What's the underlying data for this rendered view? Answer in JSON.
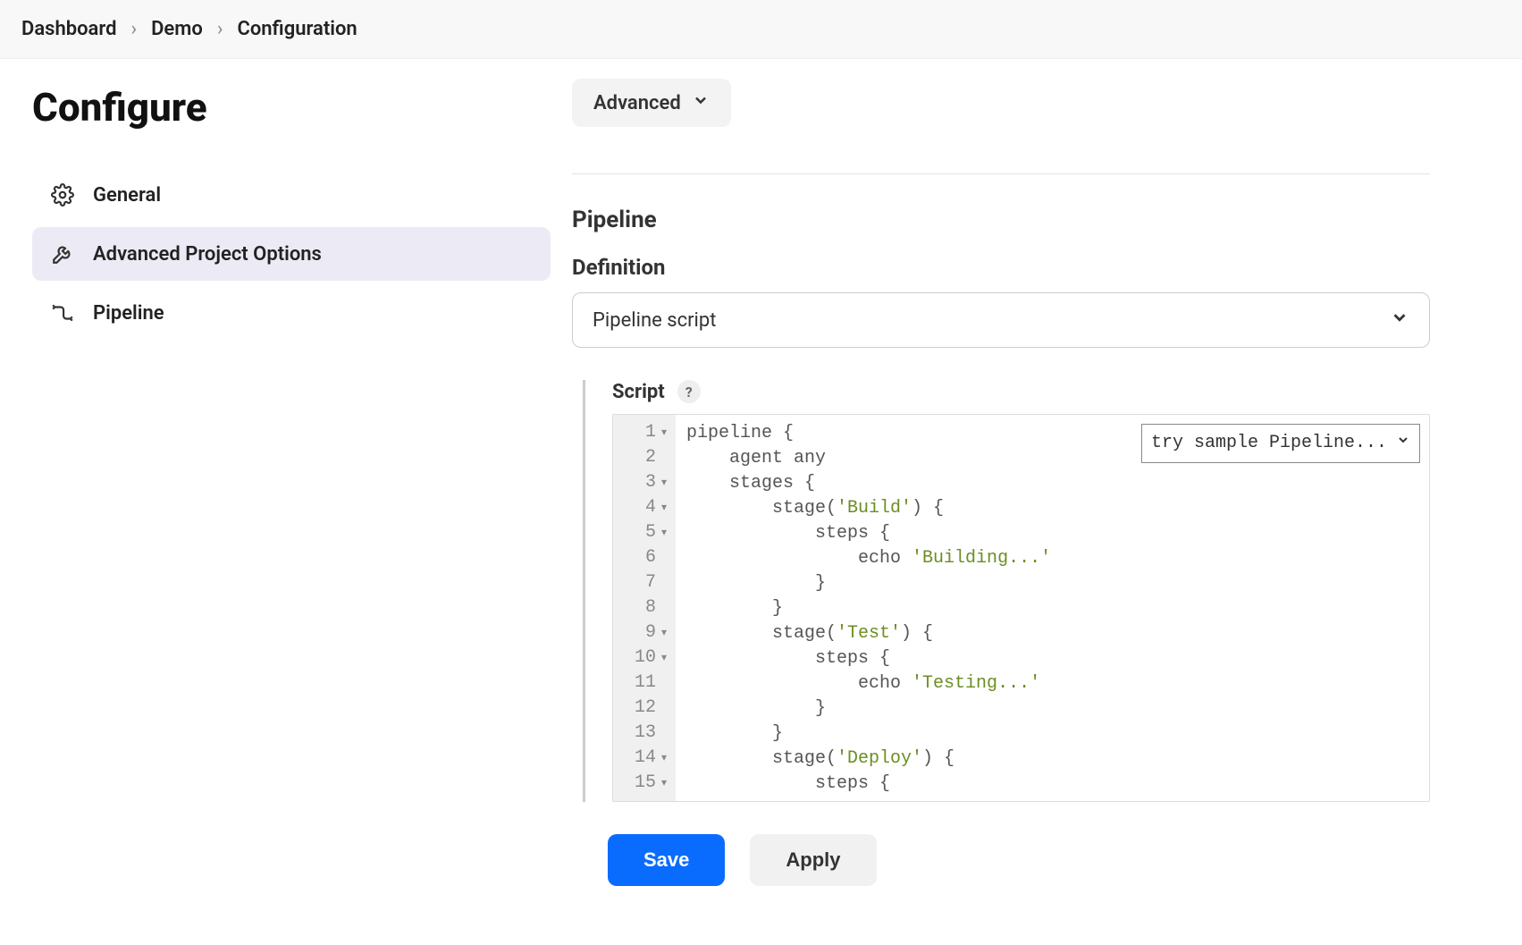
{
  "breadcrumb": {
    "items": [
      "Dashboard",
      "Demo",
      "Configuration"
    ]
  },
  "page": {
    "title": "Configure"
  },
  "sidebar": {
    "items": [
      {
        "label": "General"
      },
      {
        "label": "Advanced Project Options"
      },
      {
        "label": "Pipeline"
      }
    ],
    "active_index": 1
  },
  "advanced_section": {
    "label": "Advanced"
  },
  "pipeline": {
    "heading": "Pipeline",
    "definition_label": "Definition",
    "definition_value": "Pipeline script",
    "script_label": "Script",
    "help_symbol": "?",
    "sample_dropdown": "try sample Pipeline...",
    "code_lines": [
      {
        "n": 1,
        "fold": true,
        "tokens": [
          [
            "kw",
            "pipeline {"
          ]
        ]
      },
      {
        "n": 2,
        "fold": false,
        "tokens": [
          [
            "kw",
            "    agent any"
          ]
        ]
      },
      {
        "n": 3,
        "fold": true,
        "tokens": [
          [
            "kw",
            "    stages {"
          ]
        ]
      },
      {
        "n": 4,
        "fold": true,
        "tokens": [
          [
            "kw",
            "        stage("
          ],
          [
            "str",
            "'Build'"
          ],
          [
            "kw",
            ") {"
          ]
        ]
      },
      {
        "n": 5,
        "fold": true,
        "tokens": [
          [
            "kw",
            "            steps {"
          ]
        ]
      },
      {
        "n": 6,
        "fold": false,
        "tokens": [
          [
            "kw",
            "                echo "
          ],
          [
            "str",
            "'Building...'"
          ]
        ]
      },
      {
        "n": 7,
        "fold": false,
        "tokens": [
          [
            "kw",
            "            }"
          ]
        ]
      },
      {
        "n": 8,
        "fold": false,
        "tokens": [
          [
            "kw",
            "        }"
          ]
        ]
      },
      {
        "n": 9,
        "fold": true,
        "tokens": [
          [
            "kw",
            "        stage("
          ],
          [
            "str",
            "'Test'"
          ],
          [
            "kw",
            ") {"
          ]
        ]
      },
      {
        "n": 10,
        "fold": true,
        "tokens": [
          [
            "kw",
            "            steps {"
          ]
        ]
      },
      {
        "n": 11,
        "fold": false,
        "tokens": [
          [
            "kw",
            "                echo "
          ],
          [
            "str",
            "'Testing...'"
          ]
        ]
      },
      {
        "n": 12,
        "fold": false,
        "tokens": [
          [
            "kw",
            "            }"
          ]
        ]
      },
      {
        "n": 13,
        "fold": false,
        "tokens": [
          [
            "kw",
            "        }"
          ]
        ]
      },
      {
        "n": 14,
        "fold": true,
        "tokens": [
          [
            "kw",
            "        stage("
          ],
          [
            "str",
            "'Deploy'"
          ],
          [
            "kw",
            ") {"
          ]
        ]
      },
      {
        "n": 15,
        "fold": true,
        "tokens": [
          [
            "kw",
            "            steps {"
          ]
        ]
      }
    ]
  },
  "footer": {
    "save": "Save",
    "apply": "Apply"
  }
}
